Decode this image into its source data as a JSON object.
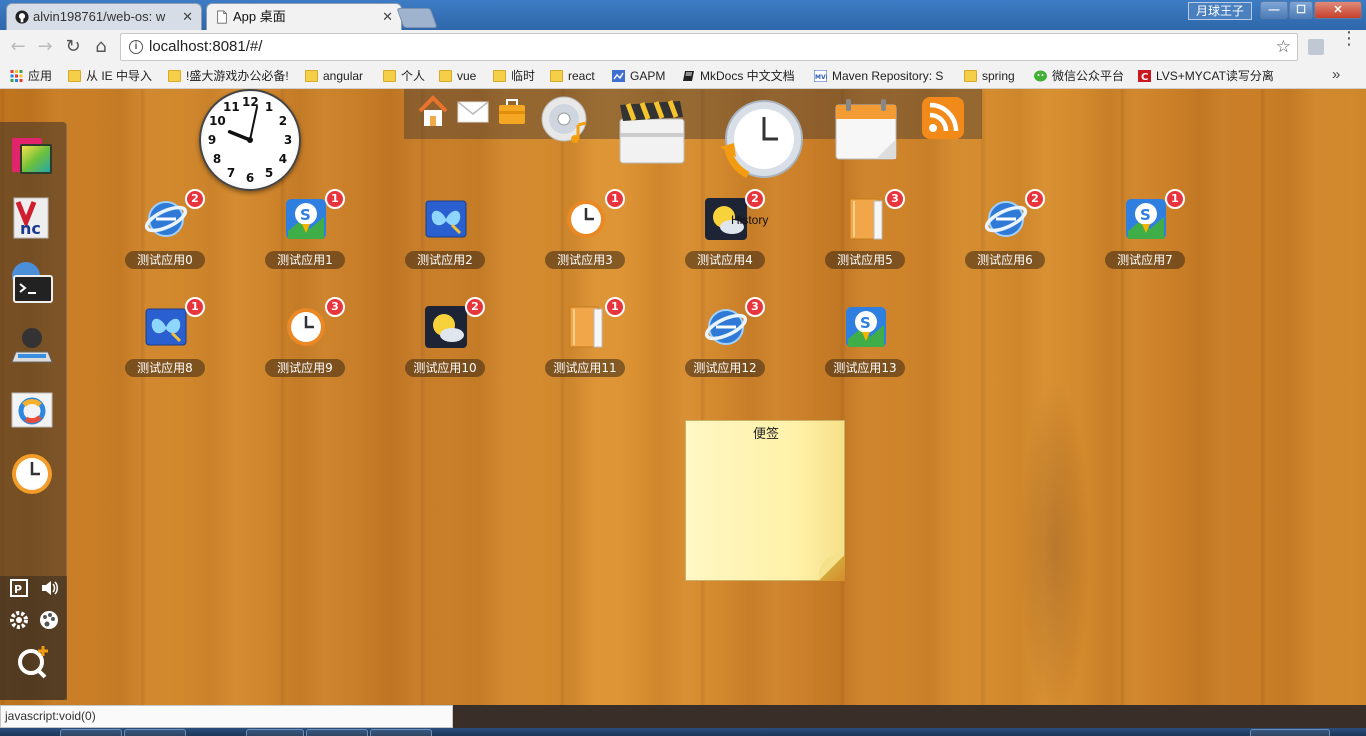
{
  "tabs": [
    {
      "title": "alvin198761/web-os: w",
      "active": false,
      "favicon": "github-icon"
    },
    {
      "title": "App 桌面",
      "active": true,
      "favicon": "page-icon"
    }
  ],
  "window": {
    "user": "月球王子",
    "minimize": "—",
    "maximize": "☐",
    "close": "✕"
  },
  "toolbar": {
    "url": "localhost:8081/#/"
  },
  "bookmarks": [
    {
      "label": "应用",
      "icon": "apps-grid-icon"
    },
    {
      "label": "从 IE 中导入",
      "icon": "folder-icon"
    },
    {
      "label": "!盛大游戏办公必备!",
      "icon": "folder-icon"
    },
    {
      "label": "angular",
      "icon": "folder-icon"
    },
    {
      "label": "个人",
      "icon": "folder-icon"
    },
    {
      "label": "vue",
      "icon": "folder-icon"
    },
    {
      "label": "临时",
      "icon": "folder-icon"
    },
    {
      "label": "react",
      "icon": "folder-icon"
    },
    {
      "label": "GAPM",
      "icon": "gapm-icon"
    },
    {
      "label": "MkDocs 中文文档",
      "icon": "book-icon"
    },
    {
      "label": "Maven Repository: S",
      "icon": "maven-icon"
    },
    {
      "label": "spring",
      "icon": "folder-icon"
    },
    {
      "label": "微信公众平台",
      "icon": "wechat-icon"
    },
    {
      "label": "LVS+MYCAT读写分离",
      "icon": "csdn-icon"
    }
  ],
  "clock": {
    "numbers": [
      "12",
      "1",
      "2",
      "3",
      "4",
      "5",
      "6",
      "7",
      "8",
      "9",
      "10",
      "11"
    ],
    "hour_hand_deg": 292,
    "minute_hand_deg": 12
  },
  "topdock": [
    {
      "name": "home-icon"
    },
    {
      "name": "mail-icon"
    },
    {
      "name": "briefcase-icon"
    },
    {
      "name": "cd-music-icon"
    },
    {
      "name": "clapperboard-icon"
    },
    {
      "name": "history-clock-icon"
    },
    {
      "name": "calendar-icon"
    },
    {
      "name": "rss-icon"
    }
  ],
  "apps": [
    {
      "label": "测试应用0",
      "badge": "2",
      "icon": "ie-globe-icon"
    },
    {
      "label": "测试应用1",
      "badge": "1",
      "icon": "sogou-map-icon"
    },
    {
      "label": "测试应用2",
      "badge": "",
      "icon": "butterfly-icon"
    },
    {
      "label": "测试应用3",
      "badge": "1",
      "icon": "clock-icon"
    },
    {
      "label": "测试应用4",
      "badge": "2",
      "icon": "weather-icon",
      "overlay": "History"
    },
    {
      "label": "测试应用5",
      "badge": "3",
      "icon": "notebook-icon"
    },
    {
      "label": "测试应用6",
      "badge": "2",
      "icon": "ie-globe-icon"
    },
    {
      "label": "测试应用7",
      "badge": "1",
      "icon": "sogou-map-icon"
    },
    {
      "label": "测试应用8",
      "badge": "1",
      "icon": "butterfly-icon"
    },
    {
      "label": "测试应用9",
      "badge": "3",
      "icon": "clock-icon"
    },
    {
      "label": "测试应用10",
      "badge": "2",
      "icon": "weather-icon"
    },
    {
      "label": "测试应用11",
      "badge": "1",
      "icon": "notebook-icon"
    },
    {
      "label": "测试应用12",
      "badge": "3",
      "icon": "ie-globe-icon"
    },
    {
      "label": "测试应用13",
      "badge": "",
      "icon": "sogou-map-icon"
    }
  ],
  "note": {
    "title": "便签"
  },
  "status": {
    "text": "javascript:void(0)"
  }
}
